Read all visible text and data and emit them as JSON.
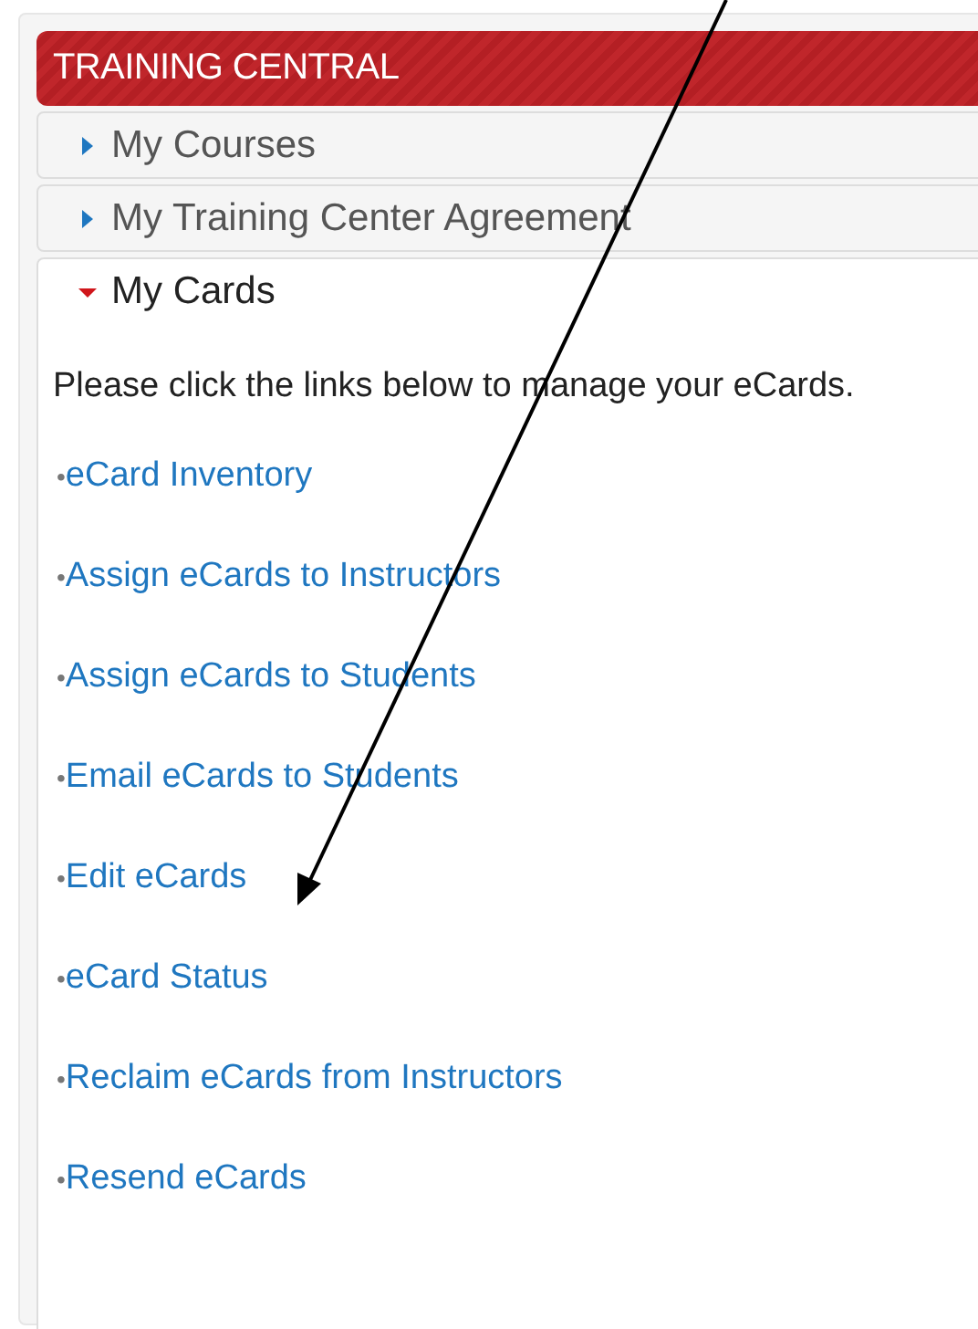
{
  "header": {
    "title": "TRAINING CENTRAL"
  },
  "sections": [
    {
      "label": "My Courses",
      "expanded": false
    },
    {
      "label": "My Training Center Agreement",
      "expanded": false
    },
    {
      "label": "My Cards",
      "expanded": true
    }
  ],
  "intro": "Please click the links below to manage your eCards.",
  "links": [
    {
      "bullet": "•",
      "label": "eCard Inventory"
    },
    {
      "bullet": "•",
      "label": "Assign eCards to Instructors"
    },
    {
      "bullet": "•",
      "label": "Assign eCards to Students"
    },
    {
      "bullet": "•",
      "label": "Email eCards to Students"
    },
    {
      "bullet": "•",
      "label": "Edit eCards"
    },
    {
      "bullet": "•",
      "label": "eCard Status"
    },
    {
      "bullet": "•",
      "label": "Reclaim eCards from Instructors"
    },
    {
      "bullet": "•",
      "label": "Resend eCards"
    }
  ]
}
